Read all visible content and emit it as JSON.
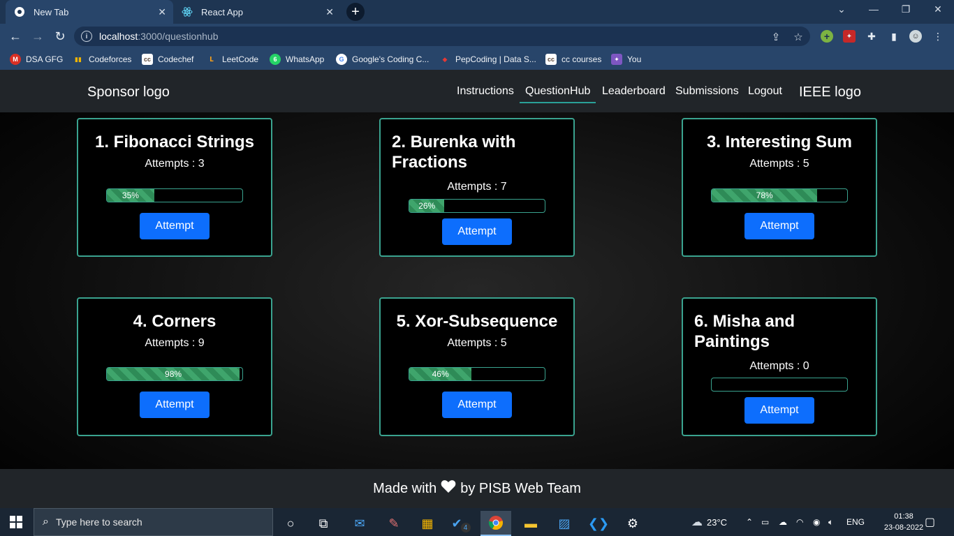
{
  "browser": {
    "tabs": [
      {
        "title": "New Tab",
        "icon": "chrome-icon",
        "active": true
      },
      {
        "title": "React App",
        "icon": "react-icon",
        "active": false
      }
    ],
    "url_host": "localhost",
    "url_path": ":3000/questionhub",
    "bookmarks": [
      {
        "label": "DSA GFG",
        "icon": "gmail-icon",
        "color": "#d93025",
        "glyph": "M"
      },
      {
        "label": "Codeforces",
        "icon": "codeforces-icon",
        "color": "#f0b400",
        "glyph": "▮"
      },
      {
        "label": "Codechef",
        "icon": "codechef-icon",
        "color": "#5b4638",
        "glyph": "cc"
      },
      {
        "label": "LeetCode",
        "icon": "leetcode-icon",
        "color": "#333333",
        "glyph": "L"
      },
      {
        "label": "WhatsApp",
        "icon": "whatsapp-icon",
        "color": "#25d366",
        "glyph": "6"
      },
      {
        "label": "Google's Coding C...",
        "icon": "google-icon",
        "color": "#ffffff",
        "glyph": "G"
      },
      {
        "label": "PepCoding | Data S...",
        "icon": "pepcoding-icon",
        "color": "#b3261e",
        "glyph": "◆"
      },
      {
        "label": "cc courses",
        "icon": "codechef-icon",
        "color": "#5b4638",
        "glyph": "cc"
      },
      {
        "label": "You",
        "icon": "you-icon",
        "color": "#7e57c2",
        "glyph": "Y"
      }
    ]
  },
  "navbar": {
    "sponsor": "Sponsor logo",
    "links": [
      "Instructions",
      "QuestionHub",
      "Leaderboard",
      "Submissions",
      "Logout"
    ],
    "active_link": "QuestionHub",
    "ieee": "IEEE logo",
    "accent": "#2aa198"
  },
  "questions": [
    {
      "title": "1. Fibonacci Strings",
      "attempts": "Attempts : 3",
      "progress": 35,
      "progress_label": "35%",
      "button": "Attempt"
    },
    {
      "title": "2. Burenka with Fractions",
      "attempts": "Attempts : 7",
      "progress": 26,
      "progress_label": "26%",
      "button": "Attempt"
    },
    {
      "title": "3. Interesting Sum",
      "attempts": "Attempts : 5",
      "progress": 78,
      "progress_label": "78%",
      "button": "Attempt"
    },
    {
      "title": "4. Corners",
      "attempts": "Attempts : 9",
      "progress": 98,
      "progress_label": "98%",
      "button": "Attempt"
    },
    {
      "title": "5. Xor-Subsequence",
      "attempts": "Attempts : 5",
      "progress": 46,
      "progress_label": "46%",
      "button": "Attempt"
    },
    {
      "title": "6. Misha and Paintings",
      "attempts": "Attempts : 0",
      "progress": 0,
      "progress_label": "",
      "button": "Attempt"
    }
  ],
  "footer": {
    "before": "Made with",
    "after": "by PISB Web Team"
  },
  "taskbar": {
    "search_placeholder": "Type here to search",
    "weather": "23°C",
    "lang": "ENG",
    "time": "01:38",
    "date": "23-08-2022",
    "todo_badge": "4"
  },
  "colors": {
    "card_border": "#3aa38f",
    "button": "#0d6efd",
    "progress": "#2e8b57"
  }
}
